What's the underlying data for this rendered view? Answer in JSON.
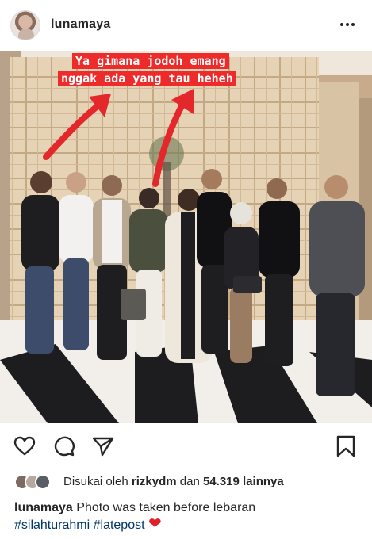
{
  "post": {
    "username": "lunamaya",
    "overlay_text": [
      "Ya gimana jodoh emang",
      "nggak ada yang tau heheh"
    ]
  },
  "icons": {
    "more": "more-horizontal-icon",
    "like": "heart-outline-icon",
    "comment": "comment-bubble-icon",
    "share": "paper-plane-icon",
    "save": "bookmark-icon"
  },
  "likes": {
    "prefix": "Disukai oleh",
    "user": "rizkydm",
    "connector": "dan",
    "count": "54.319",
    "suffix": "lainnya"
  },
  "caption": {
    "username": "lunamaya",
    "text": "Photo was taken before lebaran",
    "hashtags": [
      "#silahturahmi",
      "#latepost"
    ],
    "emoji": "❤"
  },
  "colors": {
    "overlay_bg": "#ee2b2b",
    "hashtag": "#003569",
    "heart": "#e0202b"
  }
}
